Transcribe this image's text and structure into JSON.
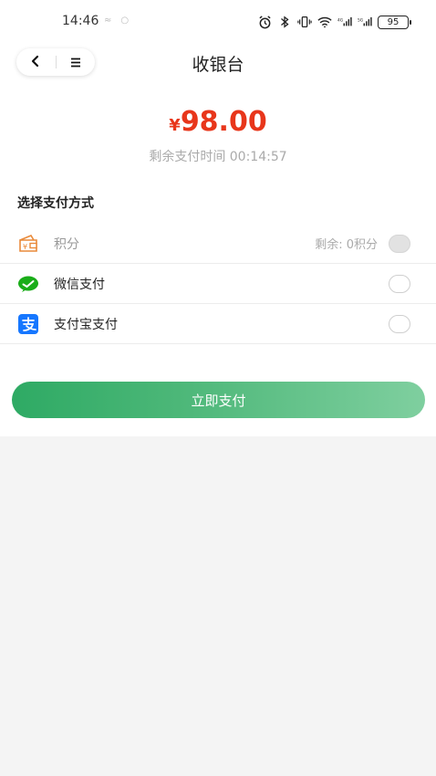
{
  "status_bar": {
    "time": "14:46",
    "battery": "95"
  },
  "nav": {
    "back_glyph": "<",
    "menu_glyph": "≡",
    "title": "收银台"
  },
  "order": {
    "currency": "¥",
    "amount": "98.00",
    "remaining_time_text": "剩余支付时间 00:14:57"
  },
  "payment": {
    "section_title": "选择支付方式",
    "methods": [
      {
        "label": "积分",
        "hint": "剩余: 0积分",
        "icon": "points-wallet-icon",
        "enabled": false
      },
      {
        "label": "微信支付",
        "icon": "wechat-pay-icon",
        "enabled": true
      },
      {
        "label": "支付宝支付",
        "icon": "alipay-icon",
        "enabled": true
      }
    ]
  },
  "submit_button": "立即支付",
  "colors": {
    "amount": "#e8361b",
    "button_start": "#2eaa64",
    "button_end": "#7fcf9f",
    "wechat": "#1aad19",
    "alipay": "#1677ff",
    "points": "#e98a3a"
  }
}
